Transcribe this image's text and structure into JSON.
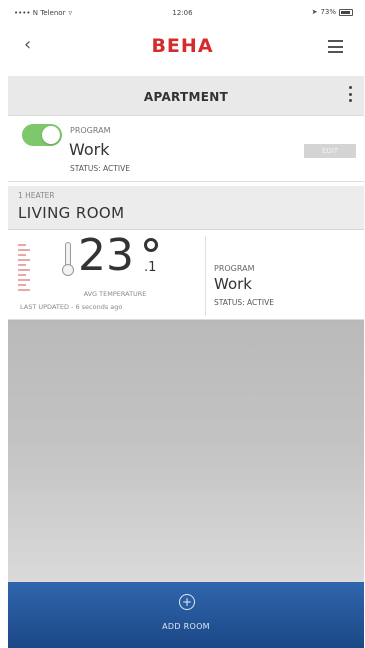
{
  "status_bar": {
    "carrier": "•••• N Telenor",
    "time": "12:06",
    "battery": "73%"
  },
  "header": {
    "back_icon": "chevron-left-icon",
    "brand": "BEHA",
    "brand_color": "#d42b2b",
    "menu_icon": "hamburger-icon"
  },
  "apartment": {
    "title": "APARTMENT",
    "options_icon": "kebab-icon"
  },
  "program": {
    "enabled": true,
    "label": "PROGRAM",
    "name": "Work",
    "status": "STATUS: ACTIVE",
    "edit_label": "EDIT",
    "toggle_color": "#7cc86a"
  },
  "room": {
    "heater_label": "1 HEATER",
    "name": "LIVING ROOM",
    "temperature_integer": "23",
    "temperature_decimal": ".1",
    "avg_label": "AVG TEMPERATURE",
    "last_updated": "LAST UPDATED - 6 seconds ago",
    "program_label": "PROGRAM",
    "program_name": "Work",
    "program_status": "STATUS: ACTIVE"
  },
  "footer": {
    "add_label": "ADD ROOM",
    "add_icon": "plus-circle-icon",
    "color": "#2a5ea6"
  }
}
